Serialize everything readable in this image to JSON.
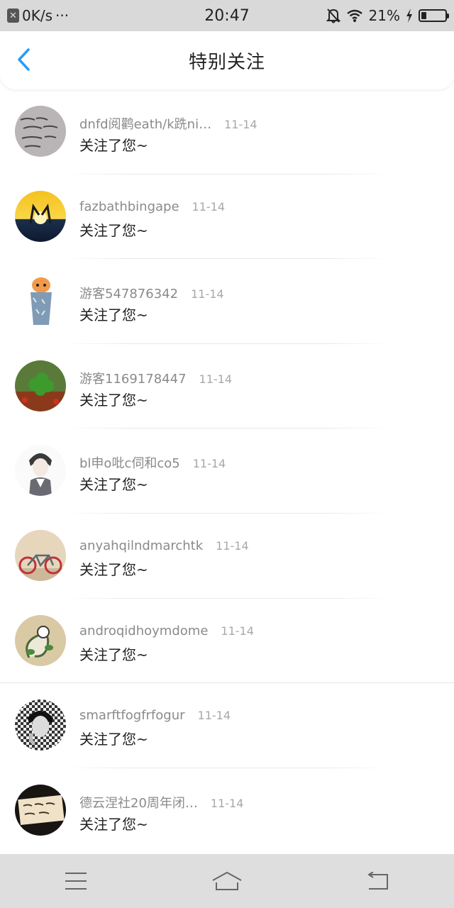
{
  "status_bar": {
    "net_speed": "0K/s",
    "dots": "···",
    "time": "20:47",
    "battery": "21%",
    "battery_level": 0.21
  },
  "header": {
    "title": "特别关注"
  },
  "items": [
    {
      "username": "dnfd阅鹳eath/k跣ni…",
      "date": "11-14",
      "action": "关注了您~"
    },
    {
      "username": "fazbathbingape",
      "date": "11-14",
      "action": "关注了您~"
    },
    {
      "username": "游客547876342",
      "date": "11-14",
      "action": "关注了您~"
    },
    {
      "username": "游客1169178447",
      "date": "11-14",
      "action": "关注了您~"
    },
    {
      "username": "bl申o吡c伺和co5",
      "date": "11-14",
      "action": "关注了您~"
    },
    {
      "username": "anyahqilndmarchtk",
      "date": "11-14",
      "action": "关注了您~"
    },
    {
      "username": "androqidhoymdome",
      "date": "11-14",
      "action": "关注了您~"
    },
    {
      "username": "smarftfogfrfogur",
      "date": "11-14",
      "action": "关注了您~"
    },
    {
      "username": "德云涅社20周年闭…",
      "date": "11-14",
      "action": "关注了您~"
    }
  ],
  "colors": {
    "accent": "#2b9bf4",
    "status_bar_bg": "#d9d9d9",
    "nav_bar_bg": "#dedede"
  }
}
